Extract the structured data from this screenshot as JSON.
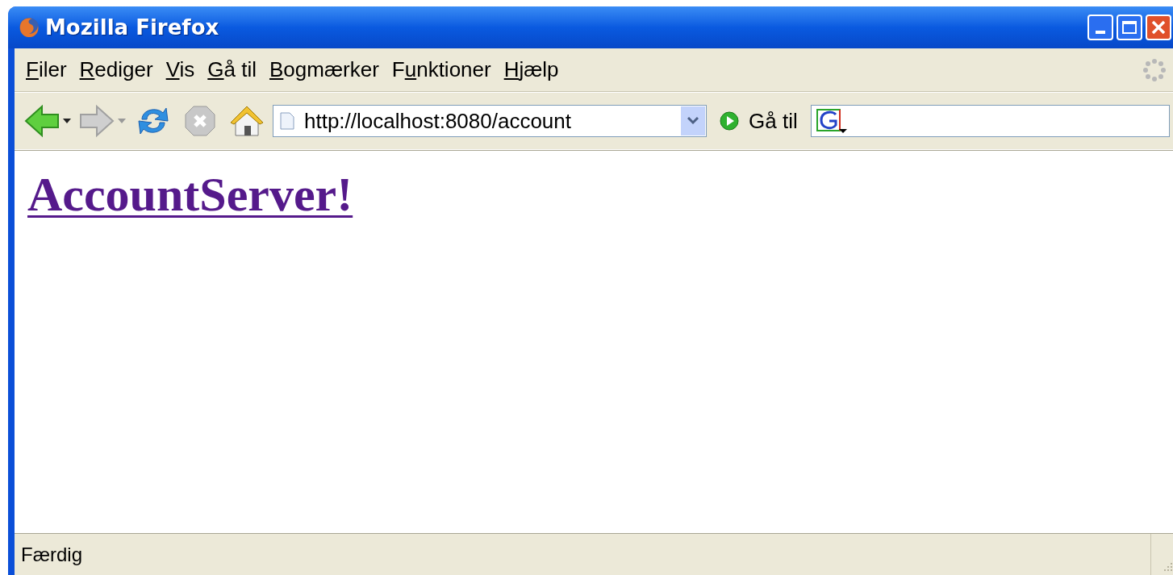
{
  "window": {
    "title": "Mozilla Firefox"
  },
  "menu": [
    {
      "key": "F",
      "suffix": "iler"
    },
    {
      "key": "R",
      "suffix": "ediger"
    },
    {
      "key": "V",
      "suffix": "is"
    },
    {
      "key": "G",
      "suffix": "å til"
    },
    {
      "key": "B",
      "suffix": "ogmærker"
    },
    {
      "prefix": "F",
      "key": "u",
      "suffix": "nktioner"
    },
    {
      "key": "H",
      "suffix": "jælp"
    }
  ],
  "toolbar": {
    "back_disabled": false,
    "forward_disabled": true,
    "address": "http://localhost:8080/account",
    "go_label": "Gå til"
  },
  "page": {
    "heading_link": "AccountServer!",
    "visited": true
  },
  "status_bar": {
    "text": "Færdig"
  }
}
